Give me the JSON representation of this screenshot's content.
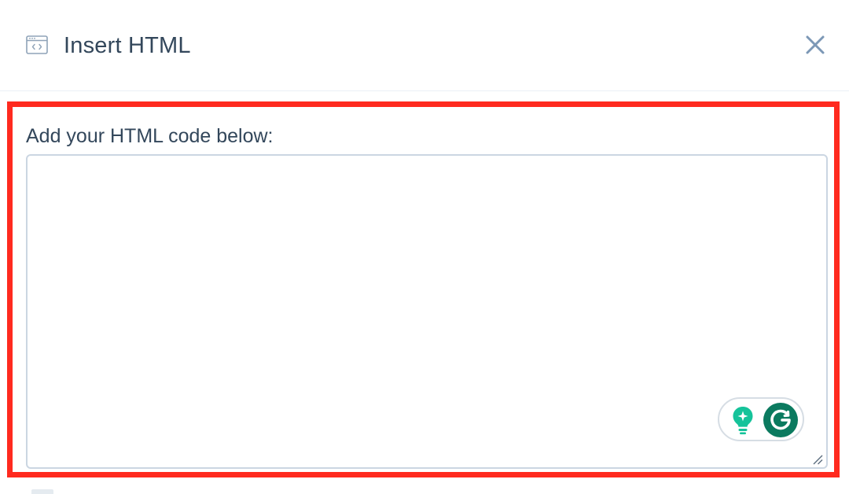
{
  "dialog": {
    "title": "Insert HTML",
    "header_icon": "code-window-icon",
    "close_icon": "close-icon"
  },
  "form": {
    "label": "Add your HTML code below:",
    "code_value": "",
    "placeholder": ""
  },
  "grammarly": {
    "suggestion_icon": "lightbulb-icon",
    "logo_icon": "grammarly-g-icon"
  },
  "colors": {
    "highlight": "#ff2a1f",
    "text": "#33475b",
    "close": "#7c98b6",
    "grammarly_teal": "#15c39a",
    "grammarly_green": "#0b7a5f"
  }
}
